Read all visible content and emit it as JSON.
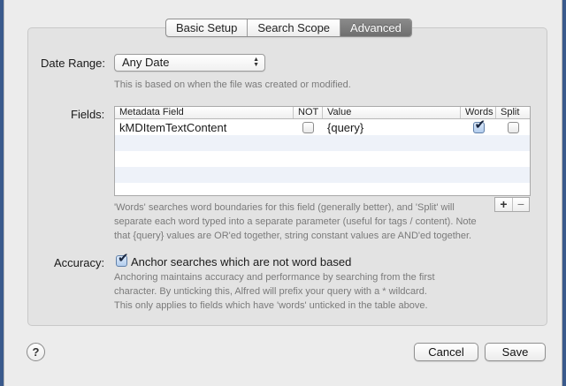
{
  "tabs": [
    {
      "label": "Basic Setup",
      "selected": false
    },
    {
      "label": "Search Scope",
      "selected": false
    },
    {
      "label": "Advanced",
      "selected": true
    }
  ],
  "date_range": {
    "label": "Date Range:",
    "value": "Any Date",
    "hint": "This is based on when the file was created or modified."
  },
  "fields": {
    "label": "Fields:",
    "columns": [
      "Metadata Field",
      "NOT",
      "Value",
      "Words",
      "Split"
    ],
    "rows": [
      {
        "field": "kMDItemTextContent",
        "not": false,
        "value": "{query}",
        "words": true,
        "split": false
      }
    ],
    "hint_lines": [
      "'Words' searches word boundaries for this field (generally better), and 'Split' will",
      "separate each word typed into a separate parameter (useful for tags / content). Note",
      "that {query} values are OR'ed together, string constant values are AND'ed together."
    ],
    "add_label": "+",
    "remove_label": "−"
  },
  "accuracy": {
    "label": "Accuracy:",
    "checkbox_label": "Anchor searches which are not word based",
    "checked": true,
    "hint_lines": [
      "Anchoring maintains accuracy and performance by searching from the first",
      "character. By unticking this, Alfred will prefix your query with a * wildcard.",
      "This only applies to fields which have 'words' unticked in the table above."
    ]
  },
  "footer": {
    "help_label": "?",
    "cancel_label": "Cancel",
    "save_label": "Save"
  },
  "colors": {
    "selected_tab": "#7c7c7c",
    "window_bg": "#ececec",
    "alt_row": "#eef2f9"
  }
}
